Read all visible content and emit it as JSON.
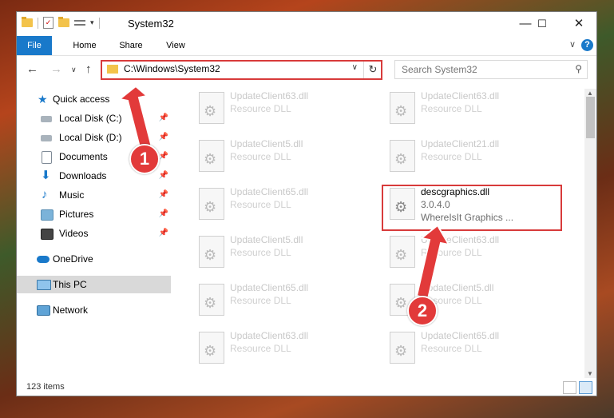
{
  "window": {
    "title": "System32",
    "minimize_glyph": "—",
    "maximize_glyph": "☐",
    "close_glyph": "✕"
  },
  "ribbon": {
    "tabs": [
      "File",
      "Home",
      "Share",
      "View"
    ],
    "help_glyph": "?",
    "collapse_glyph": "∨"
  },
  "navigation": {
    "back_glyph": "←",
    "forward_glyph": "→",
    "recent_glyph": "∨",
    "up_glyph": "↑"
  },
  "address": {
    "path": "C:\\Windows\\System32",
    "dropdown_glyph": "∨",
    "refresh_glyph": "↻"
  },
  "search": {
    "placeholder": "Search System32",
    "icon_glyph": "⚲"
  },
  "sidebar": {
    "items": [
      {
        "label": "Quick access",
        "icon": "star-icon"
      },
      {
        "label": "Local Disk (C:)",
        "icon": "drive-icon",
        "pinned": true
      },
      {
        "label": "Local Disk (D:)",
        "icon": "drive-icon",
        "pinned": true
      },
      {
        "label": "Documents",
        "icon": "documents-icon",
        "pinned": true
      },
      {
        "label": "Downloads",
        "icon": "download-icon",
        "pinned": true
      },
      {
        "label": "Music",
        "icon": "music-icon",
        "pinned": true
      },
      {
        "label": "Pictures",
        "icon": "pictures-icon",
        "pinned": true
      },
      {
        "label": "Videos",
        "icon": "video-icon",
        "pinned": true
      },
      {
        "label": "OneDrive",
        "icon": "cloud-icon"
      },
      {
        "label": "This PC",
        "icon": "computer-icon",
        "selected": true
      },
      {
        "label": "Network",
        "icon": "network-icon"
      }
    ],
    "pin_glyph": "📌"
  },
  "files": {
    "left": [
      {
        "name": "UpdateClient63.dll",
        "desc": "Resource DLL"
      },
      {
        "name": "UpdateClient5.dll",
        "desc": "Resource DLL"
      },
      {
        "name": "UpdateClient65.dll",
        "desc": "Resource DLL"
      },
      {
        "name": "UpdateClient5.dll",
        "desc": "Resource DLL"
      },
      {
        "name": "UpdateClient65.dll",
        "desc": "Resource DLL"
      },
      {
        "name": "UpdateClient63.dll",
        "desc": "Resource DLL"
      }
    ],
    "right": [
      {
        "name": "UpdateClient63.dll",
        "desc": "Resource DLL"
      },
      {
        "name": "UpdateClient21.dll",
        "desc": "Resource DLL"
      },
      {
        "name": "descgraphics.dll",
        "desc": "3.0.4.0",
        "desc2": "WhereIsIt Graphics ...",
        "active": true
      },
      {
        "name": "UpdateClient63.dll",
        "desc": "Resource DLL"
      },
      {
        "name": "UpdateClient5.dll",
        "desc": "Resource DLL"
      },
      {
        "name": "UpdateClient65.dll",
        "desc": "Resource DLL"
      }
    ]
  },
  "status": {
    "item_count": "123 items"
  },
  "annotations": {
    "step1": "1",
    "step2": "2"
  },
  "colors": {
    "accent": "#1979ca",
    "highlight": "#d83b3b"
  }
}
